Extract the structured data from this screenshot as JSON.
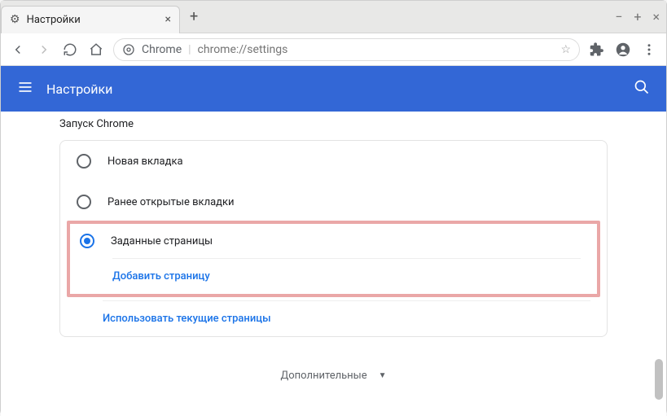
{
  "window": {
    "tab_title": "Настройки",
    "minimize": "−",
    "maximize": "+",
    "close": "×"
  },
  "toolbar": {
    "address_chrome": "Chrome",
    "address_url": "chrome://settings"
  },
  "appHeader": {
    "title": "Настройки"
  },
  "section": {
    "heading": "Запуск Chrome",
    "options": {
      "new_tab": "Новая вкладка",
      "prev_tabs": "Ранее открытые вкладки",
      "specific": "Заданные страницы"
    },
    "actions": {
      "add_page": "Добавить страницу",
      "use_current": "Использовать текущие страницы"
    }
  },
  "footer": {
    "advanced": "Дополнительные"
  }
}
